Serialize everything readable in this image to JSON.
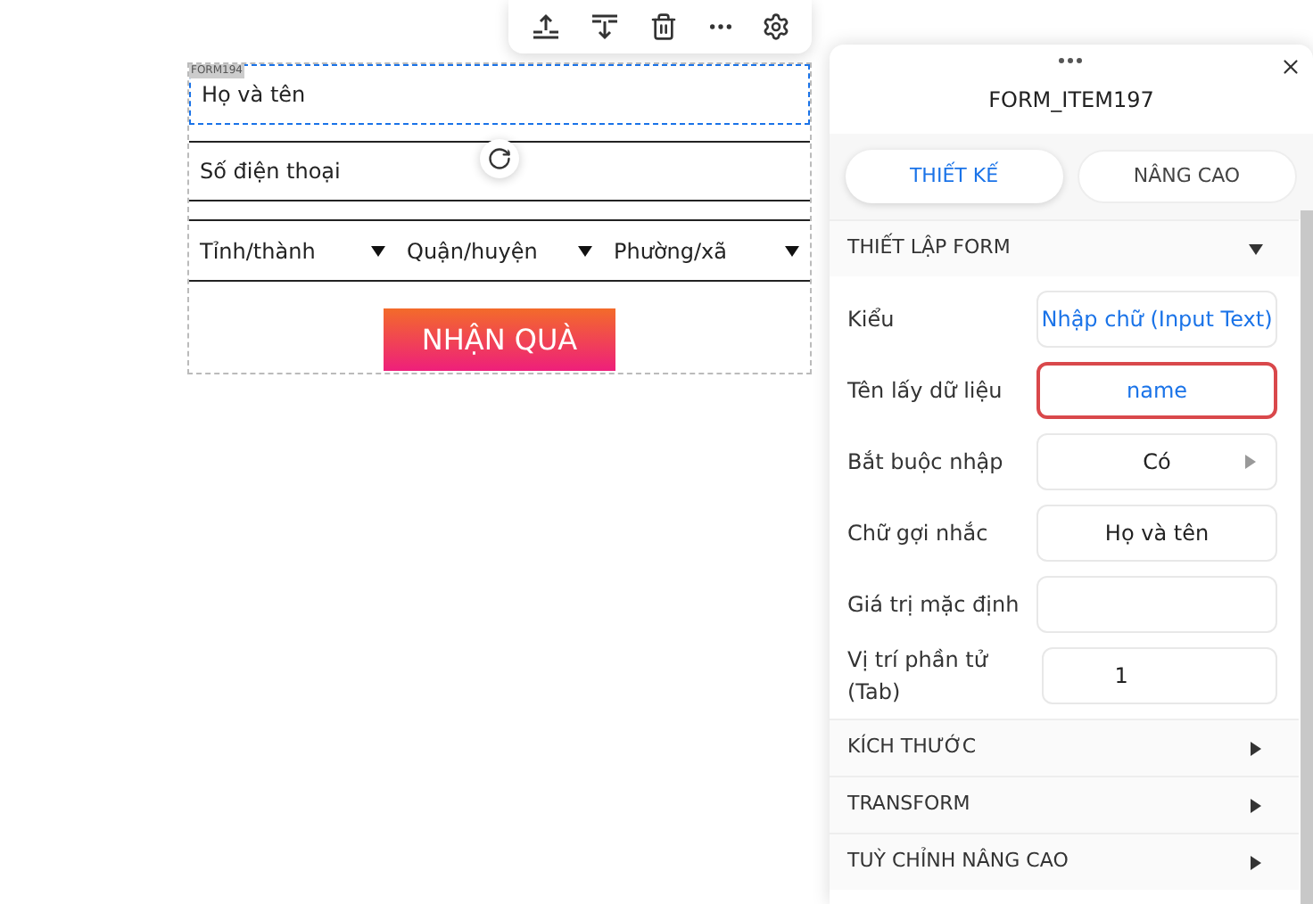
{
  "form": {
    "tag": "FORM194",
    "fields": [
      {
        "placeholder": "Họ và tên",
        "selected": true
      },
      {
        "placeholder": "Số điện thoại",
        "selected": false
      }
    ],
    "selects": [
      "Tỉnh/thành",
      "Quận/huyện",
      "Phường/xã"
    ],
    "submit": "NHẬN QUÀ"
  },
  "panel": {
    "title": "FORM_ITEM197",
    "tabs": [
      {
        "label": "THIẾT KẾ",
        "selected": true
      },
      {
        "label": "NÂNG CAO",
        "selected": false
      }
    ],
    "sections": [
      {
        "title": "THIẾT LẬP FORM",
        "expanded": true,
        "rows": [
          {
            "label": "Kiểu",
            "kind": "link",
            "value": "Nhập chữ (Input Text)",
            "highlighted": false
          },
          {
            "label": "Tên lấy dữ liệu",
            "kind": "link",
            "value": "name",
            "highlighted": true
          },
          {
            "label": "Bắt buộc nhập",
            "kind": "select",
            "value": "Có",
            "highlighted": false
          },
          {
            "label": "Chữ gợi nhắc",
            "kind": "input",
            "value": "Họ và tên",
            "highlighted": false
          },
          {
            "label": "Giá trị mặc định",
            "kind": "input",
            "highlighted": false
          },
          {
            "label": "Vị trí phần tử (Tab)",
            "kind": "number",
            "value": "1",
            "highlighted": false
          }
        ]
      },
      {
        "title": "KÍCH THƯỚC",
        "expanded": false
      },
      {
        "title": "TRANSFORM",
        "expanded": false
      },
      {
        "title": "TUỲ CHỈNH NÂNG CAO",
        "expanded": false
      }
    ]
  }
}
